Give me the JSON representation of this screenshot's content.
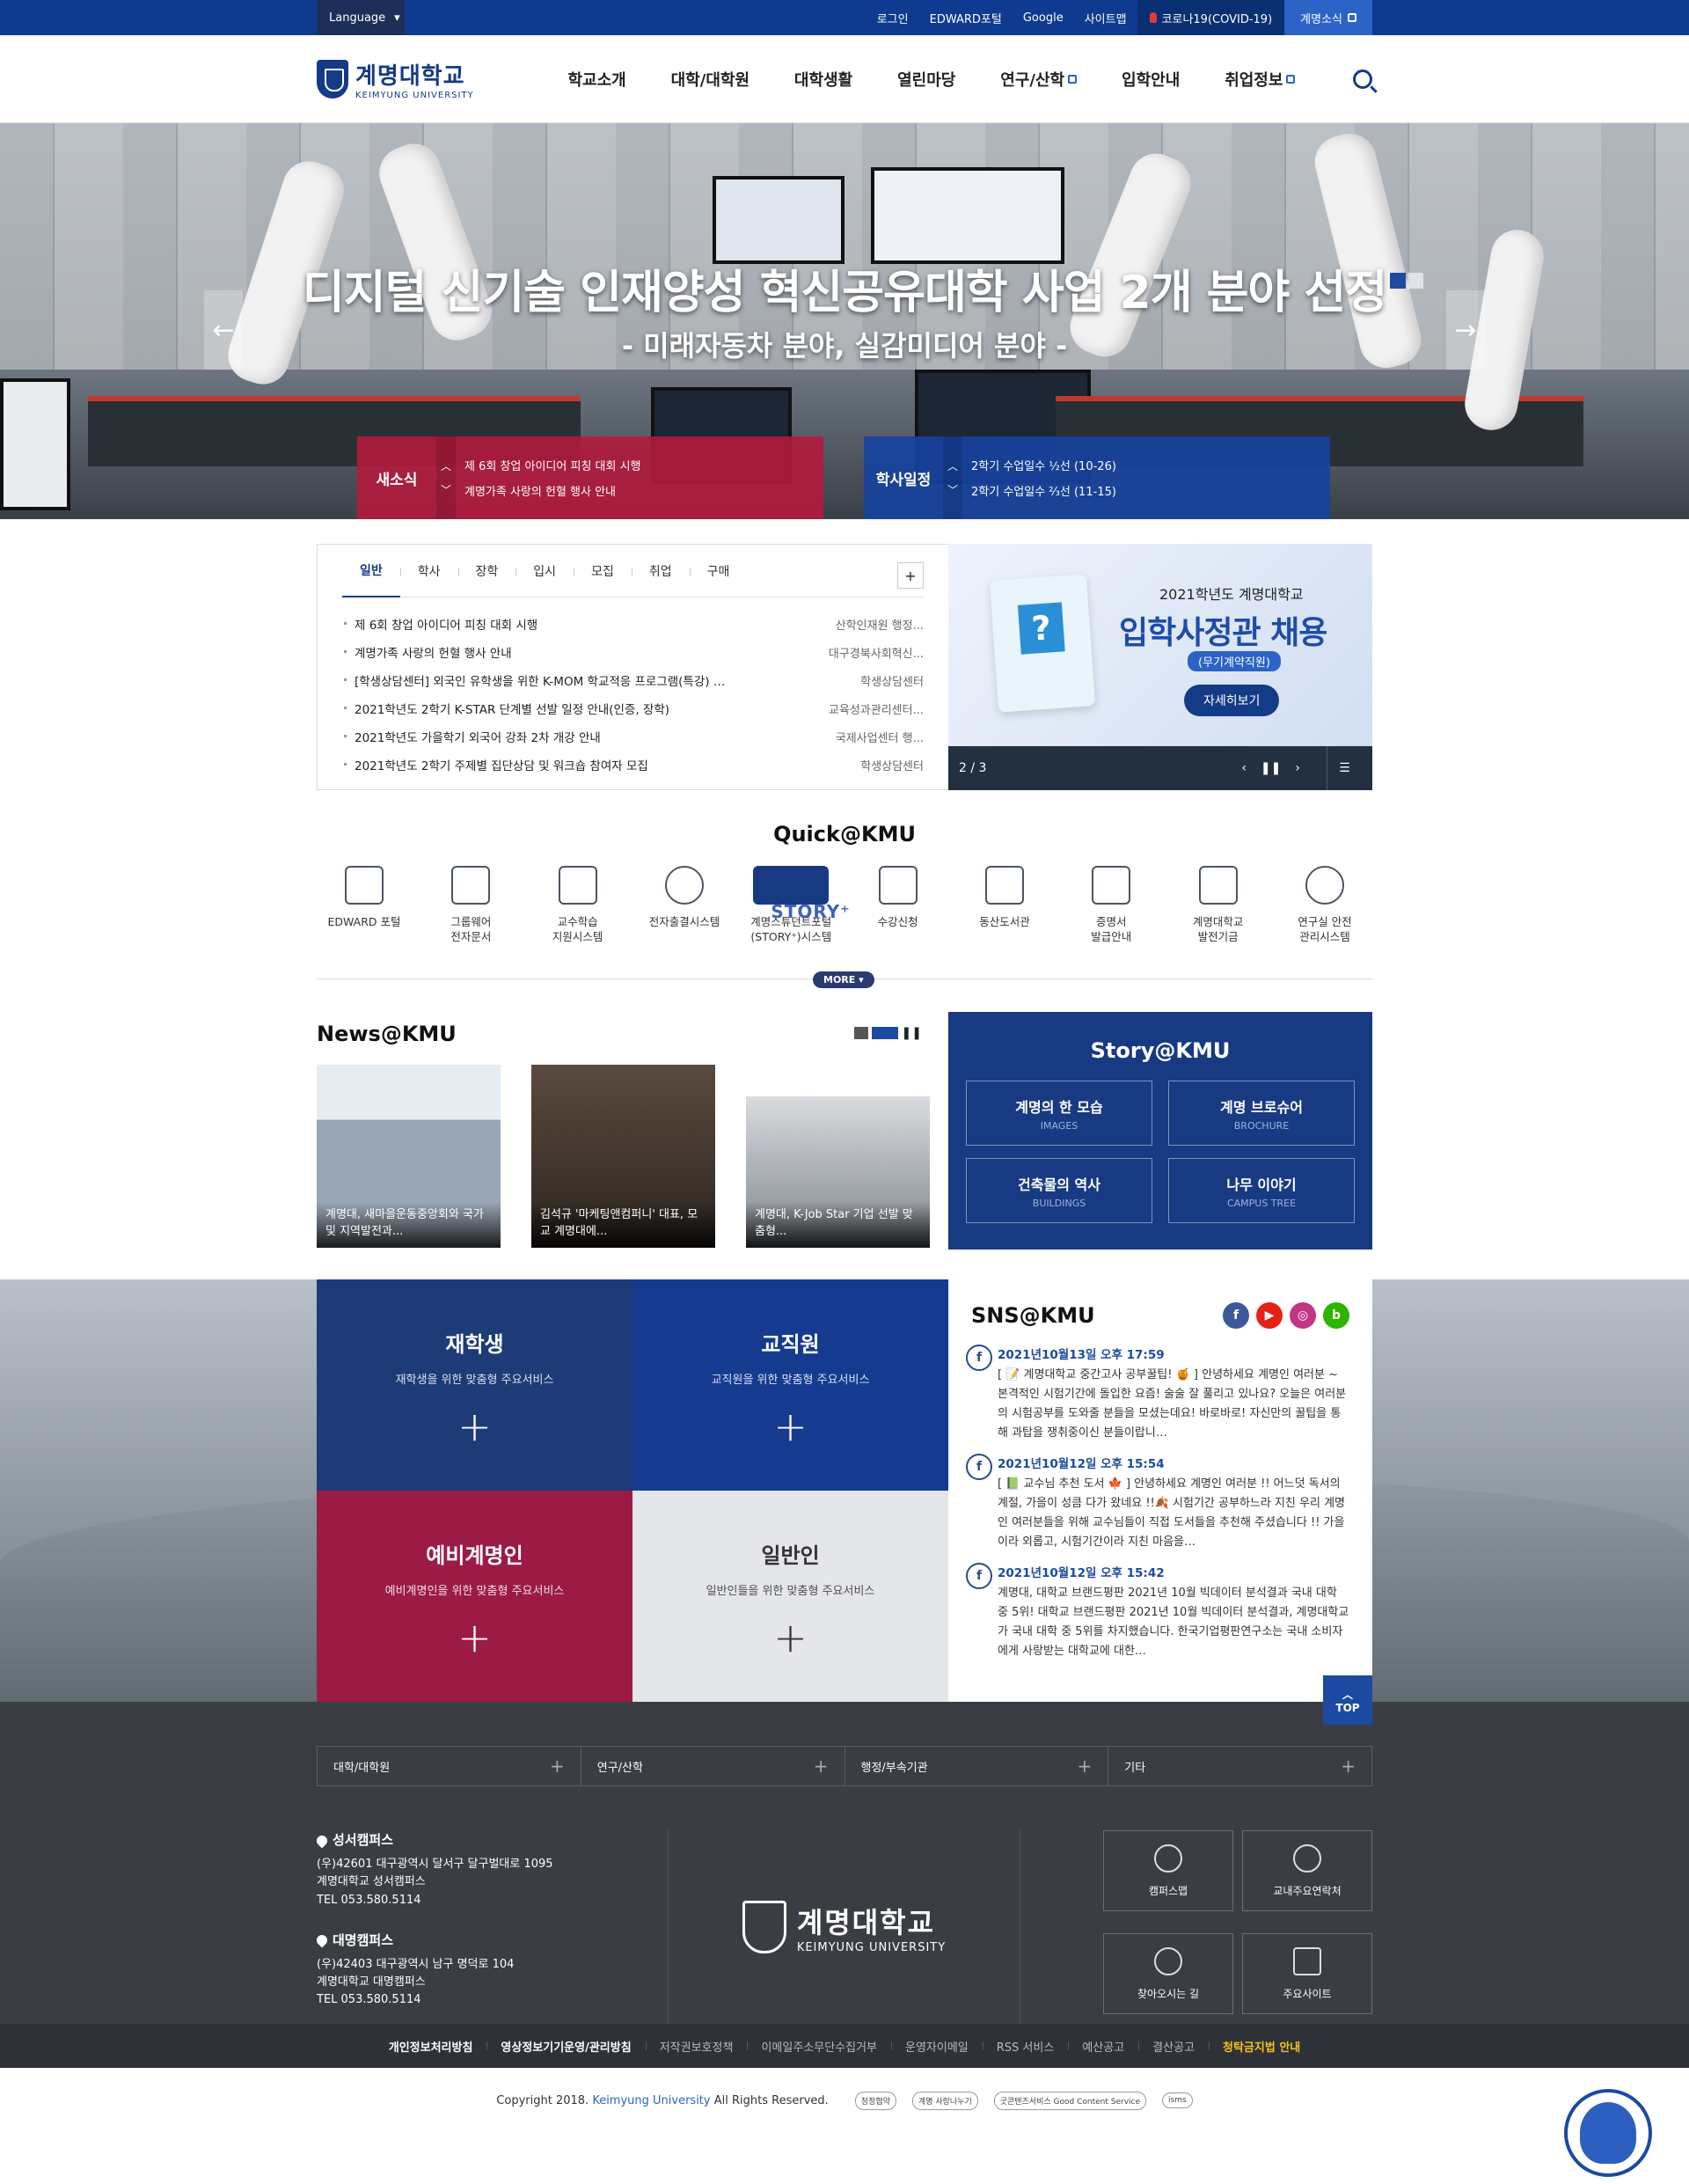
{
  "topbar": {
    "language": "Language",
    "links": [
      "로그인",
      "EDWARD포털",
      "Google",
      "사이트맵"
    ],
    "covid": "코로나19(COVID-19)",
    "news": "계명소식"
  },
  "header": {
    "logo_ko": "계명대학교",
    "logo_en": "KEIMYUNG UNIVERSITY",
    "menu": [
      "학교소개",
      "대학/대학원",
      "대학생활",
      "열린마당",
      "연구/산학",
      "입학안내",
      "취업정보"
    ]
  },
  "hero": {
    "title": "디지털 신기술 인재양성 혁신공유대학 사업 2개 분야 선정",
    "subtitle": "- 미래자동차 분야, 실감미디어 분야 -",
    "news_label": "새소식",
    "news_items": [
      "제 6회 창업 아이디어 피칭 대회 시행",
      "계명가족 사랑의 헌혈 행사 안내"
    ],
    "schedule_label": "학사일정",
    "schedule_items": [
      "2학기 수업일수 ½선 (10-26)",
      "2학기 수업일수 ⅔선 (11-15)"
    ]
  },
  "board": {
    "tabs": [
      "일반",
      "학사",
      "장학",
      "입시",
      "모집",
      "취업",
      "구매"
    ],
    "more": "+",
    "rows": [
      {
        "title": "제 6회 창업 아이디어 피칭 대회 시행",
        "dept": "산학인재원 행정..."
      },
      {
        "title": "계명가족 사랑의 헌혈 행사 안내",
        "dept": "대구경북사회혁신..."
      },
      {
        "title": "[학생상담센터] 외국인 유학생을 위한 K-MOM 학교적응 프로그램(특강) …",
        "dept": "학생상담센터"
      },
      {
        "title": "2021학년도 2학기 K-STAR 단계별 선발 일정 안내(인증, 장학)",
        "dept": "교육성과관리센터..."
      },
      {
        "title": "2021학년도 가을학기 외국어 강좌 2차 개강 안내",
        "dept": "국제사업센터 행..."
      },
      {
        "title": "2021학년도 2학기 주제별 집단상담 및 워크숍 참여자 모집",
        "dept": "학생상담센터"
      }
    ]
  },
  "banner": {
    "line1": "2021학년도 계명대학교",
    "line2": "입학사정관 채용",
    "line3": "(무기계약직원)",
    "cta": "자세히보기",
    "counter": "2 / 3"
  },
  "quick": {
    "title": "Quick@KMU",
    "items": [
      {
        "label": "EDWARD 포털",
        "icon": "lock-icon"
      },
      {
        "label": "그룹웨어\n전자문서",
        "icon": "monitor-icon"
      },
      {
        "label": "교수학습\n지원시스템",
        "icon": "graduation-cap-icon"
      },
      {
        "label": "전자출결시스템",
        "icon": "mouse-icon"
      },
      {
        "label": "계명스튜던트포털\n(STORY⁺)시스템",
        "icon": "story-logo-icon"
      },
      {
        "label": "수강신청",
        "icon": "calendar-icon"
      },
      {
        "label": "동산도서관",
        "icon": "books-icon"
      },
      {
        "label": "증명서\n발급안내",
        "icon": "printer-icon"
      },
      {
        "label": "계명대학교\n발전기금",
        "icon": "paper-plane-icon"
      },
      {
        "label": "연구실 안전\n관리시스템",
        "icon": "flask-icon"
      }
    ],
    "more": "MORE"
  },
  "news": {
    "title": "News@KMU",
    "items": [
      "계명대, 새마을운동중앙회와 국가 및 지역발전과...",
      "김석규 '마케팅앤컴퍼니' 대표, 모교 계명대에...",
      "계명대, K-Job Star 기업 선발 맞춤형..."
    ]
  },
  "story": {
    "title": "Story@KMU",
    "items": [
      {
        "ko": "계명의 한 모습",
        "en": "IMAGES"
      },
      {
        "ko": "계명 브로슈어",
        "en": "BROCHURE"
      },
      {
        "ko": "건축물의 역사",
        "en": "BUILDINGS"
      },
      {
        "ko": "나무 이야기",
        "en": "CAMPUS TREE"
      }
    ]
  },
  "targets": [
    {
      "title": "재학생",
      "desc": "재학생을 위한 맞춤형 주요서비스"
    },
    {
      "title": "교직원",
      "desc": "교직원을 위한 맞춤형 주요서비스"
    },
    {
      "title": "예비계명인",
      "desc": "예비계명인을 위한 맞춤형 주요서비스"
    },
    {
      "title": "일반인",
      "desc": "일반인들을 위한 맞춤형 주요서비스"
    }
  ],
  "sns": {
    "title": "SNS@KMU",
    "posts": [
      {
        "date": "2021년10월13일 오후 17:59",
        "text": "[ 📝 계명대학교 중간고사 공부꿀팁! 🍯 ] 안녕하세요 계명인 여러분 ~ 본격적인 시험기간에 돌입한 요즘! 술술 잘 풀리고 있나요? 오늘은 여러분의 시험공부를 도와줄 분들을 모셨는데요! 바로바로! 자신만의 꿀팁을 통해 과탑을 쟁취중이신 분들이랍니…"
      },
      {
        "date": "2021년10월12일 오후 15:54",
        "text": "[ 📗 교수님 추천 도서 🍁 ] 안녕하세요 계명인 여러분 !! 어느덧 독서의 계절, 가을이 성큼 다가 왔네요 !!🍂 시험기간 공부하느라 지친 우리 계명인 여러분들을 위해 교수님들이 직접 도서들을 추천해 주셨습니다 !! 가을이라 외롭고, 시험기간이라 지친 마음을…"
      },
      {
        "date": "2021년10월12일 오후 15:42",
        "text": "계명대, 대학교 브랜드평판 2021년 10월 빅데이터 분석결과 국내 대학 중 5위! 대학교 브랜드평판 2021년 10월 빅데이터 분석결과, 계명대학교가 국내 대학 중 5위를 차지했습니다. 한국기업평판연구소는 국내 소비자에게 사랑받는 대학교에 대한…"
      }
    ],
    "top": "TOP"
  },
  "footer": {
    "menus": [
      "대학/대학원",
      "연구/산학",
      "행정/부속기관",
      "기타"
    ],
    "campus1": {
      "name": "성서캠퍼스",
      "addr": "(우)42601 대구광역시 달서구 달구벌대로 1095",
      "place": "계명대학교 성서캠퍼스",
      "tel": "TEL 053.580.5114"
    },
    "campus2": {
      "name": "대명캠퍼스",
      "addr": "(우)42403 대구광역시 남구 명덕로 104",
      "place": "계명대학교 대명캠퍼스",
      "tel": "TEL 053.580.5114"
    },
    "logo_ko": "계명대학교",
    "logo_en": "KEIMYUNG UNIVERSITY",
    "buttons": [
      "캠퍼스맵",
      "교내주요연락처",
      "찾아오시는 길",
      "주요사이트"
    ],
    "policies": [
      "개인정보처리방침",
      "영상정보기기운영/관리방침",
      "저작권보호정책",
      "이메일주소무단수집거부",
      "운영자이메일",
      "RSS 서비스",
      "예산공고",
      "결산공고",
      "청탁금지법 안내"
    ],
    "copyright_pre": "Copyright 2018.",
    "copyright_brand": "Keimyung University",
    "copyright_post": "All Rights Reserved.",
    "marks": [
      "청정협약",
      "계명 사랑나누기",
      "굿콘텐츠서비스 Good Content Service",
      "isms"
    ]
  },
  "colors": {
    "primary": "#0e3b8f",
    "red": "#9b1b45",
    "footer": "#3a3d44"
  }
}
